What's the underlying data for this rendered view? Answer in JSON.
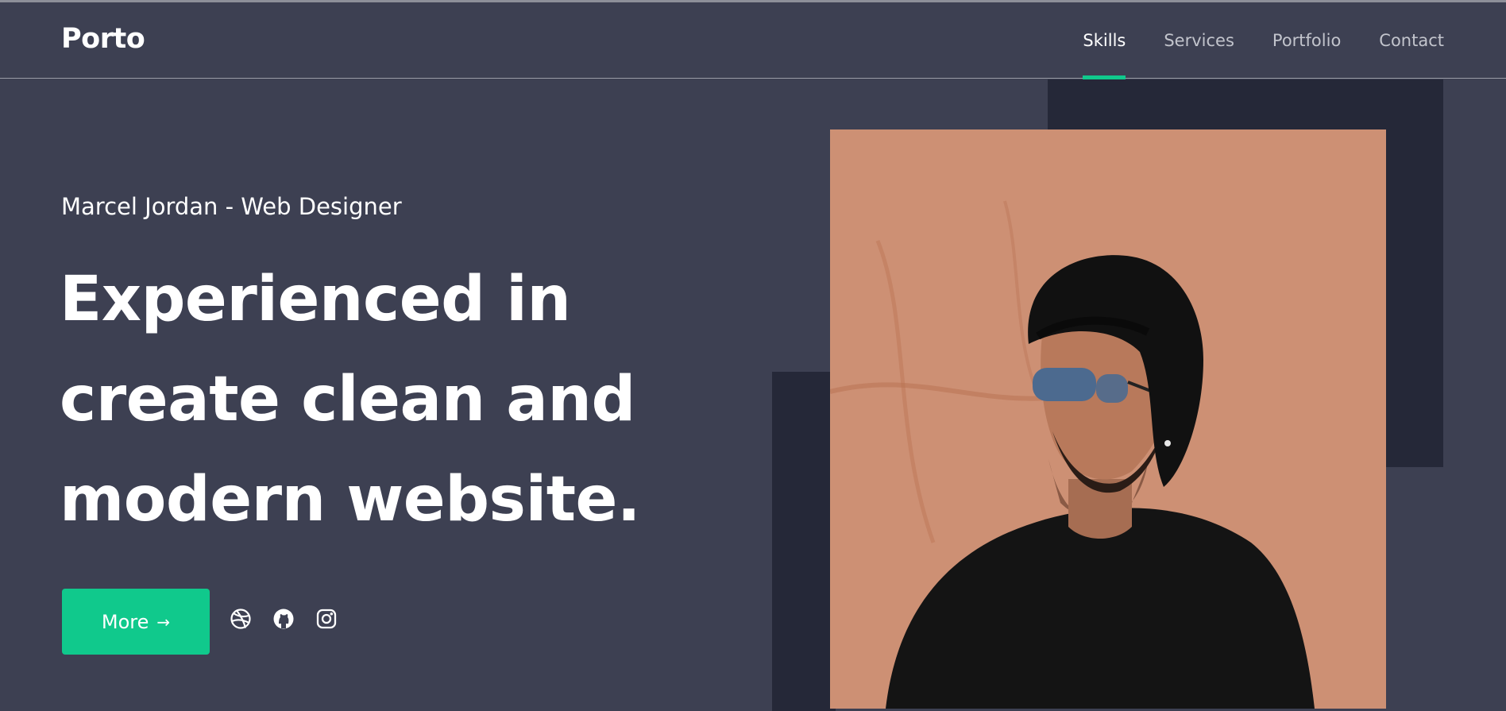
{
  "header": {
    "logo": "Porto",
    "nav": [
      {
        "label": "Skills",
        "active": true
      },
      {
        "label": "Services",
        "active": false
      },
      {
        "label": "Portfolio",
        "active": false
      },
      {
        "label": "Contact",
        "active": false
      }
    ]
  },
  "hero": {
    "subtitle": "Marcel Jordan - Web Designer",
    "headline": [
      "Experienced in",
      "create clean and",
      "modern website."
    ],
    "more_button": "More",
    "more_arrow": "→",
    "social_icons": [
      "dribbble-icon",
      "github-icon",
      "instagram-icon"
    ]
  },
  "colors": {
    "background": "#3d4052",
    "accent": "#10c98c",
    "dark_block": "#252838",
    "photo_wall": "#c98a6e"
  }
}
